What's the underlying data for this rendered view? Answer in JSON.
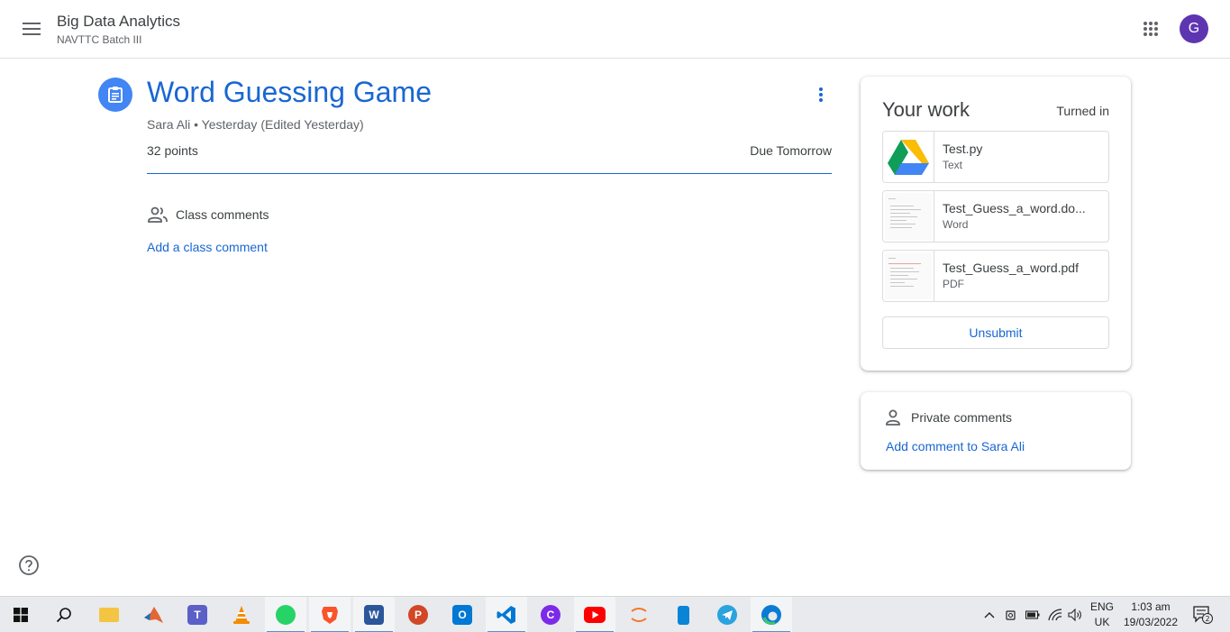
{
  "header": {
    "course_title": "Big Data Analytics",
    "course_subtitle": "NAVTTC Batch III",
    "avatar_letter": "G",
    "avatar_color": "#5e35b1"
  },
  "assignment": {
    "title": "Word Guessing Game",
    "meta": "Sara Ali • Yesterday (Edited Yesterday)",
    "points": "32 points",
    "due": "Due Tomorrow",
    "accent_color": "#1967d2",
    "class_comments_label": "Class comments",
    "add_class_comment": "Add a class comment"
  },
  "work": {
    "title": "Your work",
    "status": "Turned in",
    "attachments": [
      {
        "name": "Test.py",
        "type": "Text",
        "thumb": "google-drive-icon"
      },
      {
        "name": "Test_Guess_a_word.do...",
        "type": "Word",
        "thumb": "document-preview"
      },
      {
        "name": "Test_Guess_a_word.pdf",
        "type": "PDF",
        "thumb": "document-preview"
      }
    ],
    "unsubmit_label": "Unsubmit"
  },
  "private_comments": {
    "label": "Private comments",
    "add_label": "Add comment to Sara Ali"
  },
  "taskbar": {
    "apps": [
      "windows-start-icon",
      "search-icon",
      "file-explorer-icon",
      "matlab-icon",
      "teams-icon",
      "vlc-icon",
      "whatsapp-icon",
      "brave-icon",
      "word-icon",
      "powerpoint-icon",
      "outlook-icon",
      "vscode-icon",
      "canva-icon",
      "youtube-icon",
      "jupyter-icon",
      "phone-link-icon",
      "telegram-icon",
      "edge-icon"
    ],
    "language_line1": "ENG",
    "language_line2": "UK",
    "time": "1:03 am",
    "date": "19/03/2022",
    "notification_count": "2"
  }
}
